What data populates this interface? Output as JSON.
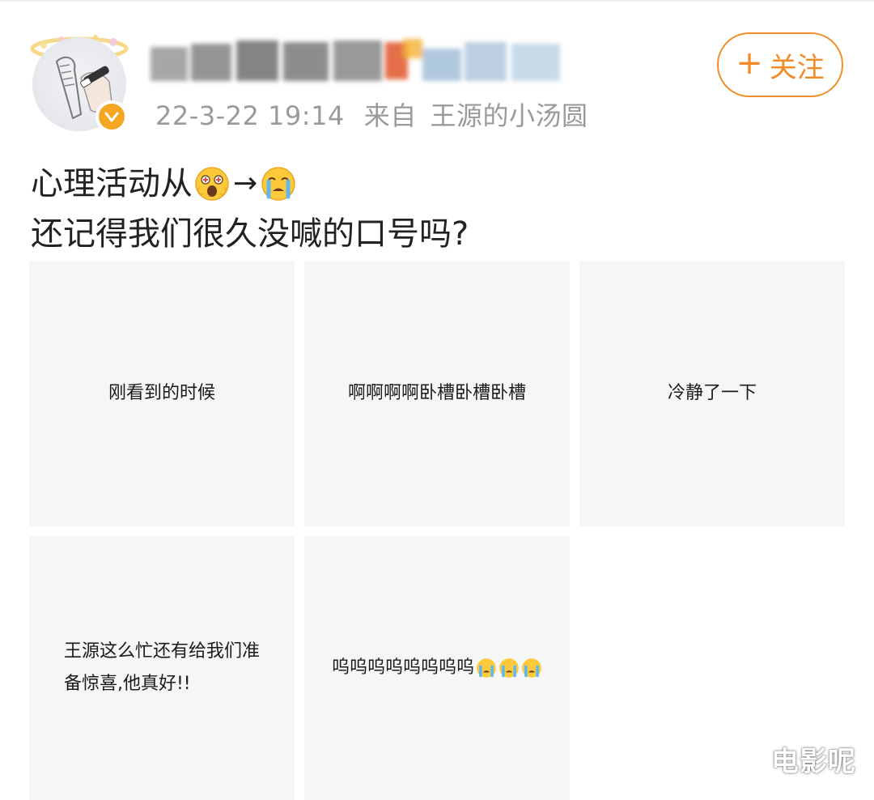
{
  "post": {
    "timestamp": "22-3-22 19:14",
    "source_label": "来自",
    "source_name": "王源的小汤圆",
    "username_visible": false,
    "verified": true,
    "follow_button": {
      "icon": "plus-icon",
      "plus": "+",
      "label": "关注"
    },
    "text_line1_prefix": "心理活动从",
    "text_line1_emoji_start": "shocked-emoji",
    "text_line1_arrow": "→",
    "text_line1_emoji_end": "crying-emoji",
    "text_line2": "还记得我们很久没喊的口号吗?"
  },
  "images": [
    {
      "text": "刚看到的时候"
    },
    {
      "text": "啊啊啊啊卧槽卧槽卧槽"
    },
    {
      "text": "冷静了一下"
    },
    {
      "text": "王源这么忙还有给我们准\n备惊喜,他真好!!"
    },
    {
      "text": "呜呜呜呜呜呜呜呜",
      "trailing_emoji": "crying-emoji",
      "trailing_emoji_count": 3
    }
  ],
  "watermark": "电影呢",
  "colors": {
    "accent": "#f28c28",
    "verified_badge": "#f5a623",
    "meta_text": "#9a9a9a",
    "tile_bg": "#f6f6f6",
    "body_text": "#222222"
  }
}
